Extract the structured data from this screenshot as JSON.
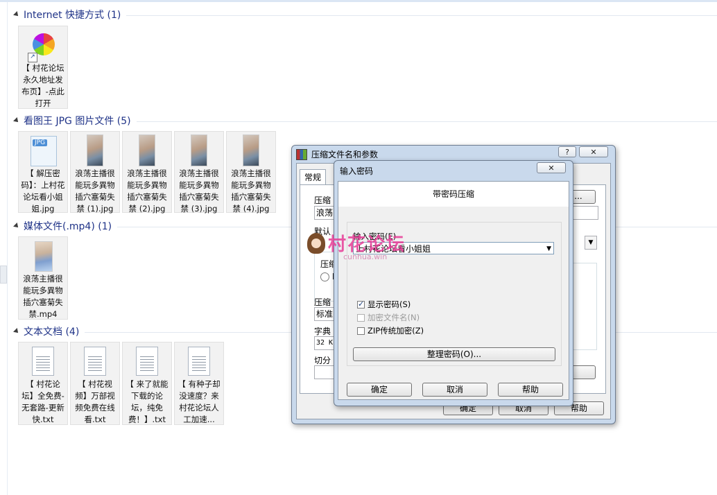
{
  "groups": [
    {
      "title": "Internet 快捷方式 (1)",
      "files": [
        {
          "name": "【 村花论坛永久地址发布页】-点此打开",
          "icon": "internet-shortcut-icon"
        }
      ]
    },
    {
      "title": "看图王 JPG 图片文件 (5)",
      "files": [
        {
          "name": "【 解压密码】：上村花论坛看小姐姐.jpg",
          "icon": "jpg-file-icon",
          "badge": "JPG"
        },
        {
          "name": "浪荡主播很能玩多異物插穴塞菊失禁 (1).jpg",
          "icon": "image-thumbnail"
        },
        {
          "name": "浪荡主播很能玩多異物插穴塞菊失禁 (2).jpg",
          "icon": "image-thumbnail"
        },
        {
          "name": "浪荡主播很能玩多異物插穴塞菊失禁 (3).jpg",
          "icon": "image-thumbnail"
        },
        {
          "name": "浪荡主播很能玩多異物插穴塞菊失禁 (4).jpg",
          "icon": "image-thumbnail"
        }
      ]
    },
    {
      "title": "媒体文件(.mp4) (1)",
      "files": [
        {
          "name": "浪荡主播很能玩多異物插穴塞菊失禁.mp4",
          "icon": "video-thumbnail"
        }
      ]
    },
    {
      "title": "文本文档 (4)",
      "files": [
        {
          "name": "【 村花论坛】全免费-无套路-更新快.txt",
          "icon": "text-file-icon"
        },
        {
          "name": "【 村花视频】万部视频免费在线看.txt",
          "icon": "text-file-icon"
        },
        {
          "name": "【 来了就能下载的论坛，纯免费！】.txt",
          "icon": "text-file-icon"
        },
        {
          "name": "【 有种子却没速度？来村花论坛人工加速...",
          "icon": "text-file-icon"
        }
      ]
    }
  ],
  "archive_dialog": {
    "title": "压缩文件名和参数",
    "help_glyph": "?",
    "close_glyph": "✕",
    "tab_general": "常规",
    "label_archive_name": "压缩",
    "archive_name_value": "浪荡",
    "label_default": "默认",
    "label_format": "压缩",
    "radio_label": "R",
    "label_method": "压缩",
    "method_value": "标准",
    "label_dict": "字典",
    "dict_value": "32 K",
    "label_split": "切分",
    "browse_label": "...",
    "ok": "确定",
    "cancel": "取消",
    "help": "帮助"
  },
  "password_dialog": {
    "title": "输入密码",
    "close_glyph": "✕",
    "heading": "带密码压缩",
    "label_password": "输入密码(E)",
    "password_value": "上村花论坛看小姐姐",
    "show_password": {
      "label": "显示密码(S)",
      "checked": true
    },
    "encrypt_names": {
      "label": "加密文件名(N)",
      "checked": false
    },
    "zip_legacy": {
      "label": "ZIP传统加密(Z)",
      "checked": false
    },
    "organize_button": "整理密码(O)...",
    "ok": "确定",
    "cancel": "取消",
    "help": "帮助"
  },
  "watermark": {
    "text": "村花论坛",
    "sub": "cunhua.win"
  }
}
